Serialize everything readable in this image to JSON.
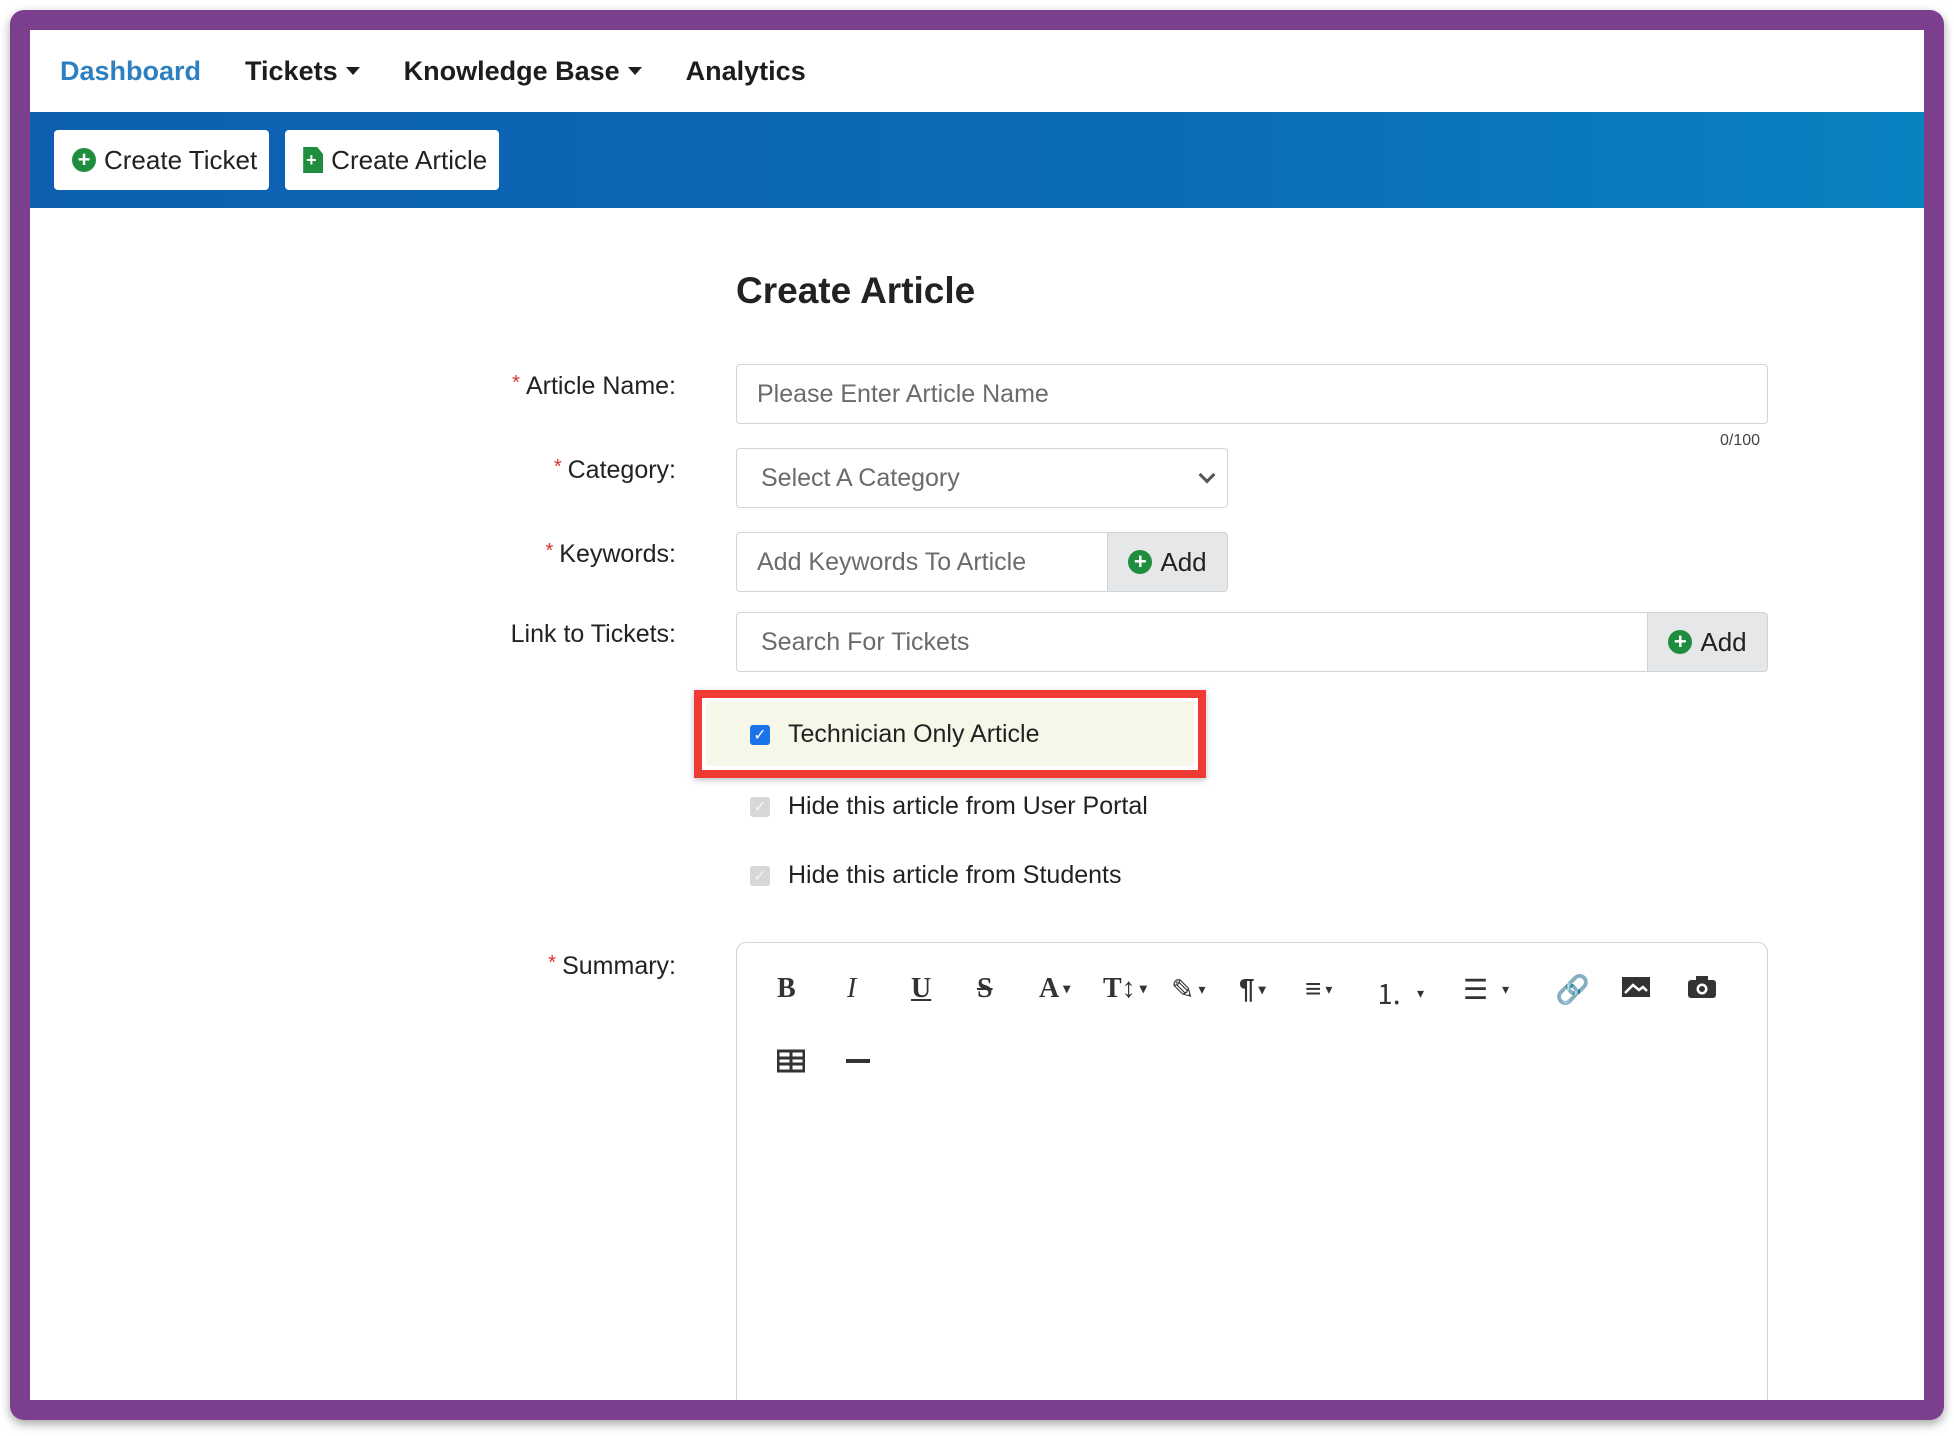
{
  "nav": {
    "items": [
      {
        "label": "Dashboard",
        "active": true,
        "dropdown": false
      },
      {
        "label": "Tickets",
        "active": false,
        "dropdown": true
      },
      {
        "label": "Knowledge Base",
        "active": false,
        "dropdown": true
      },
      {
        "label": "Analytics",
        "active": false,
        "dropdown": false
      }
    ]
  },
  "toolbar": {
    "create_ticket_label": "Create Ticket",
    "create_article_label": "Create Article"
  },
  "form": {
    "title": "Create Article",
    "article_name": {
      "label": "Article Name:",
      "placeholder": "Please Enter Article Name",
      "counter": "0/100",
      "required": true
    },
    "category": {
      "label": "Category:",
      "selected": "Select A Category",
      "required": true
    },
    "keywords": {
      "label": "Keywords:",
      "placeholder": "Add Keywords To Article",
      "add_label": "Add",
      "required": true
    },
    "link_tickets": {
      "label": "Link to Tickets:",
      "placeholder": "Search For Tickets",
      "add_label": "Add",
      "required": false
    },
    "checkboxes": [
      {
        "label": "Technician Only Article",
        "checked": true,
        "disabled": false
      },
      {
        "label": "Hide this article from User Portal",
        "checked": true,
        "disabled": true
      },
      {
        "label": "Hide this article from Students",
        "checked": true,
        "disabled": true
      }
    ],
    "summary": {
      "label": "Summary:",
      "required": true
    }
  },
  "required_marker": "*",
  "colors": {
    "nav_active": "#2c7fc0",
    "band": "#0a6cb6",
    "frame": "#7b3f8e",
    "highlight": "#ef3b36",
    "add_icon": "#1e8e3e",
    "checkbox": "#1a73e8"
  },
  "editor_toolbar": [
    "bold-icon",
    "italic-icon",
    "underline-icon",
    "strikethrough-icon",
    "font-color-icon",
    "font-size-icon",
    "style-icon",
    "paragraph-icon",
    "align-icon",
    "ordered-list-icon",
    "unordered-list-icon",
    "link-icon",
    "image-icon",
    "camera-icon",
    "table-icon",
    "horizontal-rule-icon"
  ]
}
